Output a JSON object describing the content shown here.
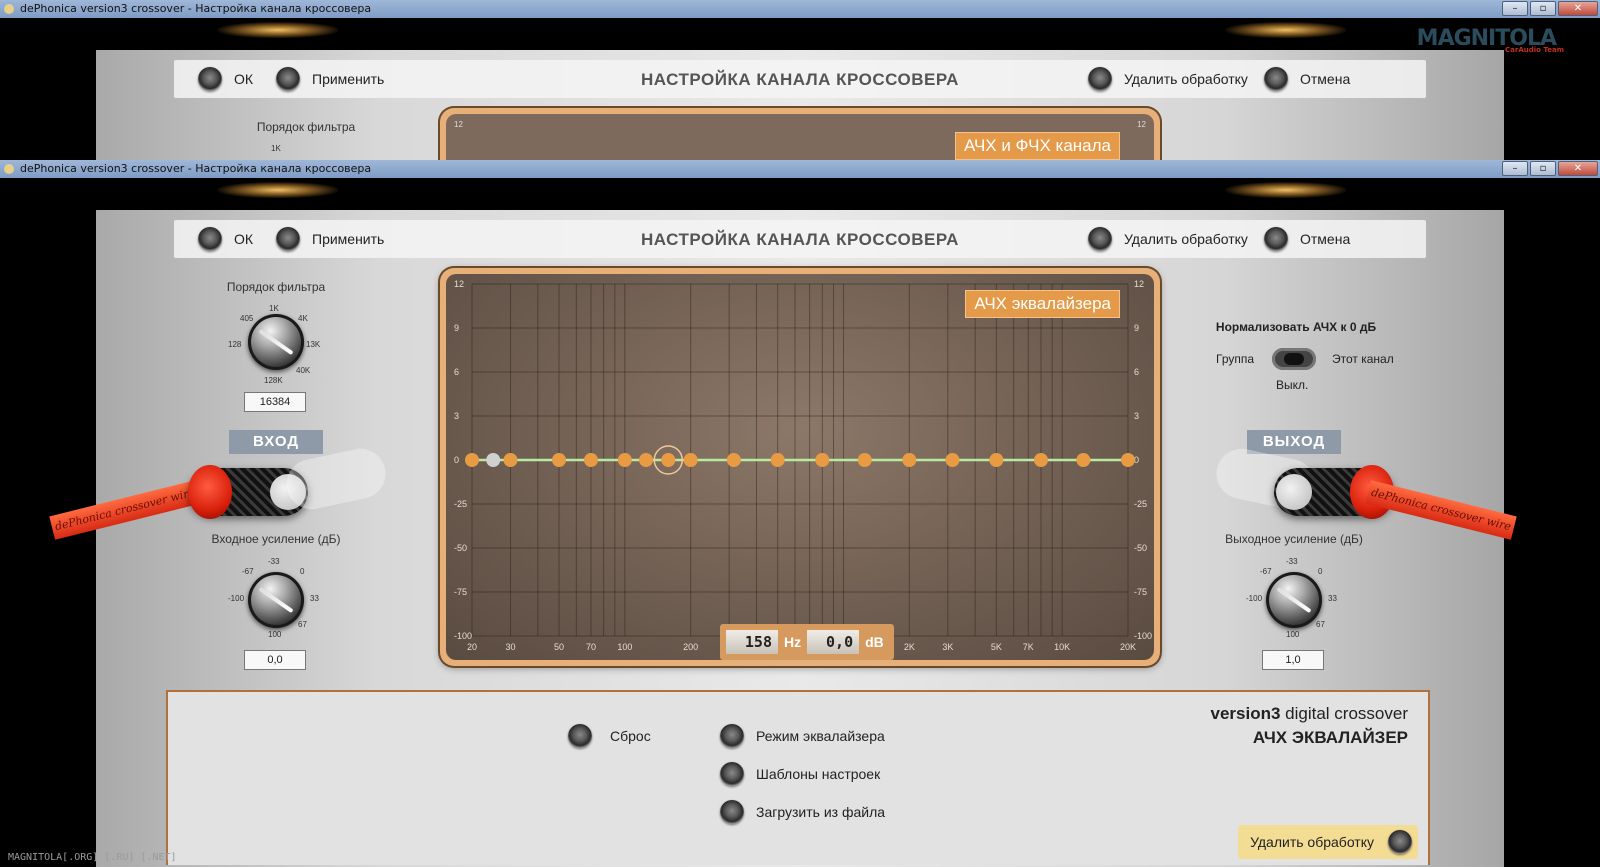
{
  "window": {
    "title": "dePhonica version3 crossover - Настройка канала кроссовера",
    "min": "–",
    "max": "▫",
    "close": "✕"
  },
  "logo": {
    "text": "MAGNITOLA",
    "sub": "CarAudio Team"
  },
  "toolbar": {
    "ok": "ОК",
    "apply": "Применить",
    "title": "НАСТРОЙКА КАНАЛА КРОССОВЕРА",
    "remove": "Удалить обработку",
    "cancel": "Отмена"
  },
  "back_graph": {
    "label": "АЧХ и ФЧХ канала",
    "y_top_left": "12",
    "y_top_right": "12"
  },
  "back_left": {
    "order_label": "Порядок фильтра",
    "scale_1k": "1K"
  },
  "left": {
    "order_label": "Порядок фильтра",
    "order_scale": {
      "s405": "405",
      "s1k": "1K",
      "s4k": "4K",
      "s128": "128",
      "s13k": "13K",
      "s40k": "40K",
      "s128k": "128K"
    },
    "order_value": "16384",
    "io_badge": "ВХОД",
    "cable_text": "dePhonica crossover wire",
    "gain_label": "Входное усиление (дБ)",
    "gain_scale": {
      "m33": "-33",
      "m67": "-67",
      "z": "0",
      "m100": "-100",
      "p33": "33",
      "p67": "67",
      "p100": "100"
    },
    "gain_value": "0,0"
  },
  "right": {
    "normalize_label": "Нормализовать АЧХ к 0 дБ",
    "group": "Группа",
    "this_channel": "Этот канал",
    "off": "Выкл.",
    "io_badge": "ВЫХОД",
    "cable_text": "dePhonica crossover wire",
    "gain_label": "Выходное усиление (дБ)",
    "gain_scale": {
      "m33": "-33",
      "m67": "-67",
      "z": "0",
      "m100": "-100",
      "p33": "33",
      "p67": "67",
      "p100": "100"
    },
    "gain_value": "1,0"
  },
  "graph": {
    "label": "АЧХ эквалайзера",
    "readout_freq": "158",
    "freq_unit": "Hz",
    "readout_gain": "0,0",
    "gain_unit": "dB",
    "y_ticks": [
      "12",
      "9",
      "6",
      "3",
      "0",
      "-25",
      "-50",
      "-75",
      "-100"
    ],
    "x_ticks": [
      "20",
      "30",
      "50",
      "70",
      "100",
      "200",
      "2K",
      "3K",
      "5K",
      "7K",
      "10K",
      "20K"
    ],
    "points_count_note": "",
    "colors": {
      "curve": "#b9e9a0",
      "point": "#e89b42",
      "selected_point": "#d0d0d0",
      "frame": "#e8b079"
    }
  },
  "chart_data": {
    "type": "line",
    "title": "АЧХ эквалайзера",
    "xlabel": "",
    "ylabel": "",
    "x_scale": "log",
    "x": [
      20,
      25,
      30,
      50,
      70,
      100,
      125,
      158,
      200,
      315,
      500,
      800,
      1250,
      2000,
      3150,
      5000,
      8000,
      12500,
      20000
    ],
    "series": [
      {
        "values": [
          0,
          0,
          0,
          0,
          0,
          0,
          0,
          0,
          0,
          0,
          0,
          0,
          0,
          0,
          0,
          0,
          0,
          0,
          0
        ]
      }
    ],
    "y_ticks": [
      12,
      9,
      6,
      3,
      0,
      -25,
      -50,
      -75,
      -100
    ],
    "x_ticks": [
      "20",
      "30",
      "50",
      "70",
      "100",
      "200",
      "2K",
      "3K",
      "5K",
      "7K",
      "10K",
      "20K"
    ],
    "grid": true,
    "selected": {
      "x": 158,
      "y": 0
    }
  },
  "bottom": {
    "reset": "Сброс",
    "eq_mode": "Режим эквалайзера",
    "presets": "Шаблоны настроек",
    "load": "Загрузить из файла",
    "brand_bold": "version3",
    "brand_rest": " digital crossover",
    "section": "АЧХ ЭКВАЛАЙЗЕР",
    "remove": "Удалить обработку"
  },
  "watermark": "MAGNITOLA[.ORG] [.RU] [.NET]"
}
